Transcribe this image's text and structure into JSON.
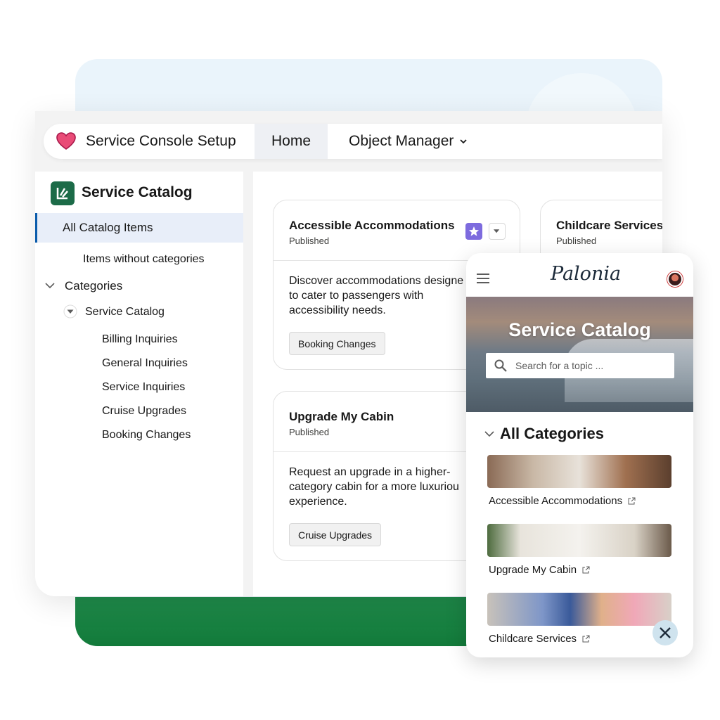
{
  "header": {
    "app_title": "Service Console Setup",
    "tab_home": "Home",
    "tab_object_manager": "Object Manager"
  },
  "sidebar": {
    "title": "Service Catalog",
    "all_items": "All Catalog Items",
    "items_without_categories": "Items without categories",
    "categories_label": "Categories",
    "tree_root": "Service Catalog",
    "tree_children": [
      "Billing Inquiries",
      "General Inquiries",
      "Service Inquiries",
      "Cruise Upgrades",
      "Booking Changes"
    ]
  },
  "cards": [
    {
      "title": "Accessible Accommodations",
      "status": "Published",
      "description_lines": [
        "Discover accommodations designe",
        "to cater to passengers with",
        "accessibility needs."
      ],
      "tag": "Booking Changes"
    },
    {
      "title": "Childcare Services",
      "status": "Published"
    },
    {
      "title": "Upgrade My Cabin",
      "status": "Published",
      "description_lines": [
        "Request an upgrade in a higher-",
        "category cabin for a more luxuriou",
        "experience."
      ],
      "tag": "Cruise Upgrades"
    }
  ],
  "mobile": {
    "brand": "Palonia",
    "hero_title": "Service Catalog",
    "search_placeholder": "Search for a topic ...",
    "categories_title": "All Categories",
    "links": [
      "Accessible Accommodations",
      "Upgrade My Cabin",
      "Childcare Services"
    ]
  },
  "icons": {
    "heart": "heart-icon",
    "catalog_logo": "catalog-logo-icon",
    "star": "star-icon",
    "menu": "hamburger-icon",
    "search": "search-icon",
    "close": "close-icon",
    "external_link": "external-link-icon"
  },
  "colors": {
    "accent_blue": "#0b5cab",
    "selected_bg": "#e8eef9",
    "catalog_green": "#1c6b48",
    "star_purple": "#7d6bde",
    "heart_pink": "#e94b77"
  }
}
